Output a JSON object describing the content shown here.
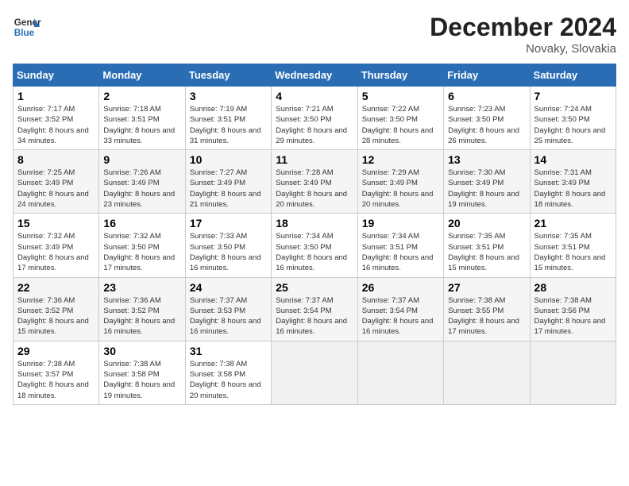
{
  "header": {
    "logo_line1": "General",
    "logo_line2": "Blue",
    "month": "December 2024",
    "location": "Novaky, Slovakia"
  },
  "weekdays": [
    "Sunday",
    "Monday",
    "Tuesday",
    "Wednesday",
    "Thursday",
    "Friday",
    "Saturday"
  ],
  "weeks": [
    [
      {
        "day": "1",
        "sunrise": "7:17 AM",
        "sunset": "3:52 PM",
        "daylight": "8 hours and 34 minutes."
      },
      {
        "day": "2",
        "sunrise": "7:18 AM",
        "sunset": "3:51 PM",
        "daylight": "8 hours and 33 minutes."
      },
      {
        "day": "3",
        "sunrise": "7:19 AM",
        "sunset": "3:51 PM",
        "daylight": "8 hours and 31 minutes."
      },
      {
        "day": "4",
        "sunrise": "7:21 AM",
        "sunset": "3:50 PM",
        "daylight": "8 hours and 29 minutes."
      },
      {
        "day": "5",
        "sunrise": "7:22 AM",
        "sunset": "3:50 PM",
        "daylight": "8 hours and 28 minutes."
      },
      {
        "day": "6",
        "sunrise": "7:23 AM",
        "sunset": "3:50 PM",
        "daylight": "8 hours and 26 minutes."
      },
      {
        "day": "7",
        "sunrise": "7:24 AM",
        "sunset": "3:50 PM",
        "daylight": "8 hours and 25 minutes."
      }
    ],
    [
      {
        "day": "8",
        "sunrise": "7:25 AM",
        "sunset": "3:49 PM",
        "daylight": "8 hours and 24 minutes."
      },
      {
        "day": "9",
        "sunrise": "7:26 AM",
        "sunset": "3:49 PM",
        "daylight": "8 hours and 23 minutes."
      },
      {
        "day": "10",
        "sunrise": "7:27 AM",
        "sunset": "3:49 PM",
        "daylight": "8 hours and 21 minutes."
      },
      {
        "day": "11",
        "sunrise": "7:28 AM",
        "sunset": "3:49 PM",
        "daylight": "8 hours and 20 minutes."
      },
      {
        "day": "12",
        "sunrise": "7:29 AM",
        "sunset": "3:49 PM",
        "daylight": "8 hours and 20 minutes."
      },
      {
        "day": "13",
        "sunrise": "7:30 AM",
        "sunset": "3:49 PM",
        "daylight": "8 hours and 19 minutes."
      },
      {
        "day": "14",
        "sunrise": "7:31 AM",
        "sunset": "3:49 PM",
        "daylight": "8 hours and 18 minutes."
      }
    ],
    [
      {
        "day": "15",
        "sunrise": "7:32 AM",
        "sunset": "3:49 PM",
        "daylight": "8 hours and 17 minutes."
      },
      {
        "day": "16",
        "sunrise": "7:32 AM",
        "sunset": "3:50 PM",
        "daylight": "8 hours and 17 minutes."
      },
      {
        "day": "17",
        "sunrise": "7:33 AM",
        "sunset": "3:50 PM",
        "daylight": "8 hours and 16 minutes."
      },
      {
        "day": "18",
        "sunrise": "7:34 AM",
        "sunset": "3:50 PM",
        "daylight": "8 hours and 16 minutes."
      },
      {
        "day": "19",
        "sunrise": "7:34 AM",
        "sunset": "3:51 PM",
        "daylight": "8 hours and 16 minutes."
      },
      {
        "day": "20",
        "sunrise": "7:35 AM",
        "sunset": "3:51 PM",
        "daylight": "8 hours and 15 minutes."
      },
      {
        "day": "21",
        "sunrise": "7:35 AM",
        "sunset": "3:51 PM",
        "daylight": "8 hours and 15 minutes."
      }
    ],
    [
      {
        "day": "22",
        "sunrise": "7:36 AM",
        "sunset": "3:52 PM",
        "daylight": "8 hours and 15 minutes."
      },
      {
        "day": "23",
        "sunrise": "7:36 AM",
        "sunset": "3:52 PM",
        "daylight": "8 hours and 16 minutes."
      },
      {
        "day": "24",
        "sunrise": "7:37 AM",
        "sunset": "3:53 PM",
        "daylight": "8 hours and 16 minutes."
      },
      {
        "day": "25",
        "sunrise": "7:37 AM",
        "sunset": "3:54 PM",
        "daylight": "8 hours and 16 minutes."
      },
      {
        "day": "26",
        "sunrise": "7:37 AM",
        "sunset": "3:54 PM",
        "daylight": "8 hours and 16 minutes."
      },
      {
        "day": "27",
        "sunrise": "7:38 AM",
        "sunset": "3:55 PM",
        "daylight": "8 hours and 17 minutes."
      },
      {
        "day": "28",
        "sunrise": "7:38 AM",
        "sunset": "3:56 PM",
        "daylight": "8 hours and 17 minutes."
      }
    ],
    [
      {
        "day": "29",
        "sunrise": "7:38 AM",
        "sunset": "3:57 PM",
        "daylight": "8 hours and 18 minutes."
      },
      {
        "day": "30",
        "sunrise": "7:38 AM",
        "sunset": "3:58 PM",
        "daylight": "8 hours and 19 minutes."
      },
      {
        "day": "31",
        "sunrise": "7:38 AM",
        "sunset": "3:58 PM",
        "daylight": "8 hours and 20 minutes."
      },
      null,
      null,
      null,
      null
    ]
  ],
  "labels": {
    "sunrise": "Sunrise:",
    "sunset": "Sunset:",
    "daylight": "Daylight:"
  }
}
